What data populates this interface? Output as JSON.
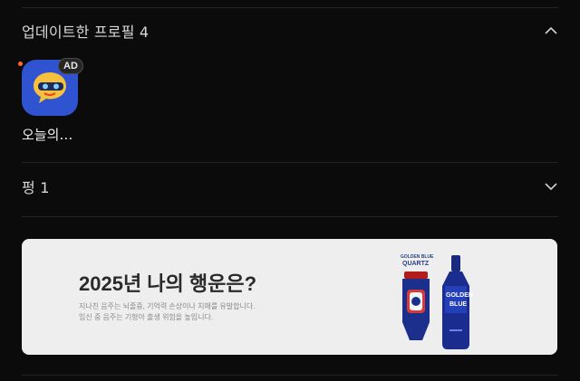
{
  "profiles_section": {
    "title": "업데이트한 프로필 4",
    "items": [
      {
        "name": "오늘의…",
        "badge": "AD",
        "icon": "chat-bubble-glasses-icon"
      }
    ]
  },
  "followers_section": {
    "title": "펑 1"
  },
  "banner": {
    "headline": "2025년 나의 행운은?",
    "warning_line1": "지나친 음주는 뇌졸중, 기억력 손상이나 치매를 유발합니다.",
    "warning_line2": "임신 중 음주는 기형아 출생 위험을 높입니다.",
    "product": {
      "logo_top": "GOLDEN BLUE",
      "logo_bottom": "QUARTZ",
      "bottle_line1": "GOLDEN",
      "bottle_line2": "BLUE"
    }
  },
  "colors": {
    "background": "#0b0b0b",
    "banner": "#eeeeee",
    "icon_bg": "#2f53d1",
    "notify_dot": "#ff6a33"
  }
}
